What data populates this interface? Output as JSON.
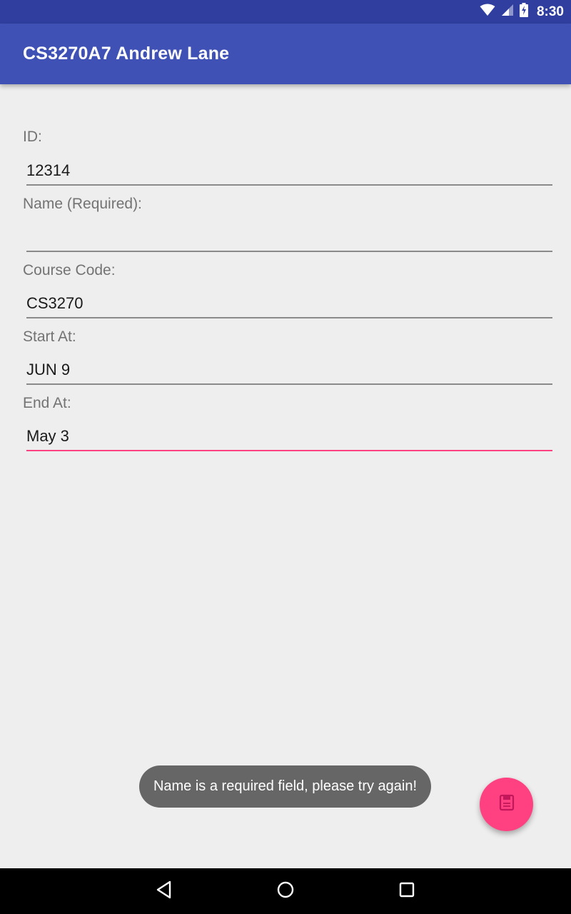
{
  "status_bar": {
    "time": "8:30",
    "icons": [
      "wifi-icon",
      "cellular-signal-icon",
      "battery-charging-icon"
    ]
  },
  "app_bar": {
    "title": "CS3270A7 Andrew Lane",
    "color": "#3f51b5"
  },
  "form": {
    "fields": [
      {
        "label": "ID:",
        "value": "12314"
      },
      {
        "label": "Name (Required):",
        "value": ""
      },
      {
        "label": "Course Code:",
        "value": "CS3270"
      },
      {
        "label": "Start At:",
        "value": "JUN 9"
      },
      {
        "label": "End At:",
        "value": "May 3"
      }
    ]
  },
  "toast": {
    "message": "Name is a required field, please try again!"
  },
  "fab": {
    "icon": "save-icon",
    "color": "#ff4081"
  },
  "nav_bar": {
    "icons": [
      "back-icon",
      "home-icon",
      "recents-icon"
    ]
  }
}
